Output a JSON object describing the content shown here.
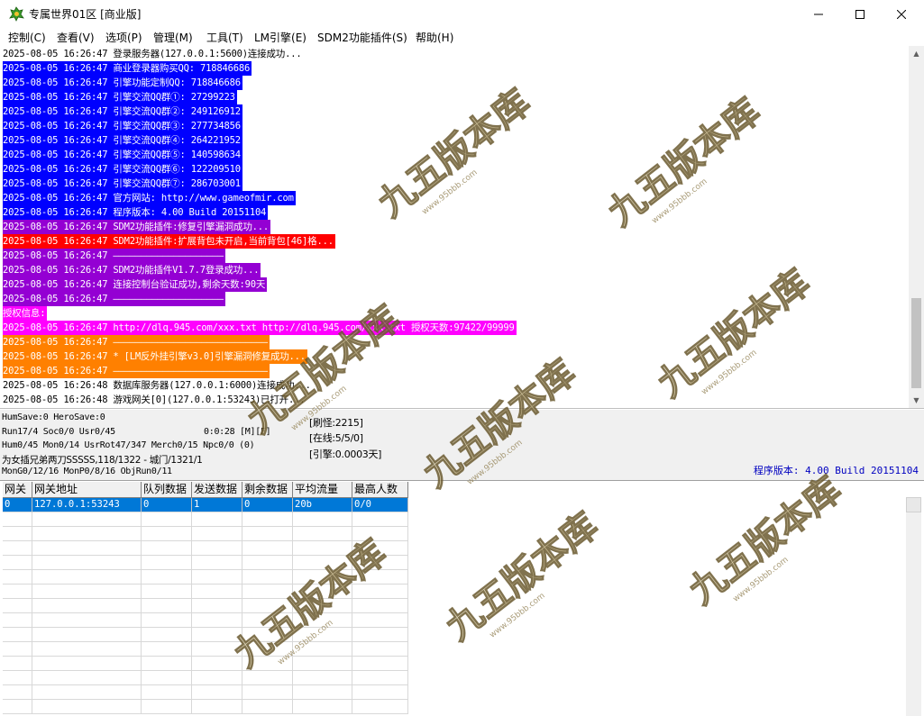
{
  "window": {
    "title": "专属世界01区 [商业版]",
    "minimize_icon": "minimize-icon",
    "maximize_icon": "maximize-icon",
    "close_icon": "close-icon"
  },
  "menu": [
    {
      "label": "控制(C)"
    },
    {
      "label": "查看(V)"
    },
    {
      "label": "选项(P)"
    },
    {
      "label": "管理(M)"
    },
    {
      "label": "工具(T)"
    },
    {
      "label": "LM引擎(E)"
    },
    {
      "label": "SDM2功能插件(S)"
    },
    {
      "label": "帮助(H)"
    }
  ],
  "log": [
    {
      "text": "2025-08-05 16:26:47 登录服务器(127.0.0.1:5600)连接成功...",
      "bg": "",
      "fg": "#000000"
    },
    {
      "text": "2025-08-05 16:26:47 商业登录器购买QQ: 718846686",
      "bg": "#0000ff",
      "fg": "#ffffff"
    },
    {
      "text": "2025-08-05 16:26:47 引擎功能定制QQ: 718846686",
      "bg": "#0000ff",
      "fg": "#ffffff"
    },
    {
      "text": "2025-08-05 16:26:47 引擎交流QQ群①: 27299223",
      "bg": "#0000ff",
      "fg": "#ffffff"
    },
    {
      "text": "2025-08-05 16:26:47 引擎交流QQ群②: 249126912",
      "bg": "#0000ff",
      "fg": "#ffffff"
    },
    {
      "text": "2025-08-05 16:26:47 引擎交流QQ群③: 277734856",
      "bg": "#0000ff",
      "fg": "#ffffff"
    },
    {
      "text": "2025-08-05 16:26:47 引擎交流QQ群④: 264221952",
      "bg": "#0000ff",
      "fg": "#ffffff"
    },
    {
      "text": "2025-08-05 16:26:47 引擎交流QQ群⑤: 140598634",
      "bg": "#0000ff",
      "fg": "#ffffff"
    },
    {
      "text": "2025-08-05 16:26:47 引擎交流QQ群⑥: 122209510",
      "bg": "#0000ff",
      "fg": "#ffffff"
    },
    {
      "text": "2025-08-05 16:26:47 引擎交流QQ群⑦: 286703001",
      "bg": "#0000ff",
      "fg": "#ffffff"
    },
    {
      "text": "2025-08-05 16:26:47 官方网站: http://www.gameofmir.com",
      "bg": "#0000ff",
      "fg": "#ffffff"
    },
    {
      "text": "2025-08-05 16:26:47 程序版本: 4.00 Build 20151104",
      "bg": "#0000ff",
      "fg": "#ffffff"
    },
    {
      "text": "2025-08-05 16:26:47 SDM2功能插件:修复引擎漏洞成功...",
      "bg": "#9400d3",
      "fg": "#ffffff"
    },
    {
      "text": "2025-08-05 16:26:47 SDM2功能插件:扩展背包未开启,当前背包[46]格...",
      "bg": "#ff0000",
      "fg": "#ffffff"
    },
    {
      "text": "2025-08-05 16:26:47 ————————————————————",
      "bg": "#9400d3",
      "fg": "#ffffff"
    },
    {
      "text": "2025-08-05 16:26:47 SDM2功能插件V1.7.7登录成功...",
      "bg": "#9400d3",
      "fg": "#ffffff"
    },
    {
      "text": "2025-08-05 16:26:47 连接控制台验证成功,剩余天数:90天",
      "bg": "#9400d3",
      "fg": "#ffffff"
    },
    {
      "text": "2025-08-05 16:26:47 ————————————————————",
      "bg": "#9400d3",
      "fg": "#ffffff"
    },
    {
      "text": "授权信息:",
      "bg": "#ff00ff",
      "fg": "#ffffff"
    },
    {
      "text": "2025-08-05 16:26:47 http://dlq.945.com/xxx.txt http://dlq.945.com/xxx.txt 授权天数:97422/99999",
      "bg": "#ff00ff",
      "fg": "#ffffff"
    },
    {
      "text": "2025-08-05 16:26:47 ————————————————————————————",
      "bg": "#ff8000",
      "fg": "#ffffff"
    },
    {
      "text": "2025-08-05 16:26:47 * [LM反外挂引擎v3.0]引擎漏洞修复成功...",
      "bg": "#ff8000",
      "fg": "#ffffff"
    },
    {
      "text": "2025-08-05 16:26:47 ————————————————————————————",
      "bg": "#ff8000",
      "fg": "#ffffff"
    },
    {
      "text": "2025-08-05 16:26:48 数据库服务器(127.0.0.1:6000)连接成功...",
      "bg": "",
      "fg": "#000000"
    },
    {
      "text": "2025-08-05 16:26:48 游戏网关[0](127.0.0.1:53243)已打开...",
      "bg": "",
      "fg": "#000000"
    }
  ],
  "status": {
    "line1": "HumSave:0 HeroSave:0",
    "line2a": "Run17/4 Soc0/0 Usr0/45",
    "line2b": "0:0:28 [M][F]",
    "line3": "Hum0/45 Mon0/14 UsrRot47/347 Merch0/15 Npc0/0 (0)",
    "line4": "为女插兄弟两刀SSSSS,118/1322 - 城门/1321/1",
    "line5": "MonG0/12/16 MonP0/8/16 ObjRun0/11",
    "refresh": "[刷怪:2215]",
    "online": "[在线:5/5/0]",
    "engine": "[引擎:0.0003天]",
    "version": "程序版本: 4.00 Build 20151104"
  },
  "table": {
    "headers": [
      "网关",
      "网关地址",
      "队列数据",
      "发送数据",
      "剩余数据",
      "平均流量",
      "最高人数"
    ],
    "rows": [
      [
        "0",
        "127.0.0.1:53243",
        "0",
        "1",
        "0",
        "20b",
        "0/0"
      ]
    ]
  },
  "watermark": {
    "main": "九五版本库",
    "sub": "www.95bbb.com"
  }
}
